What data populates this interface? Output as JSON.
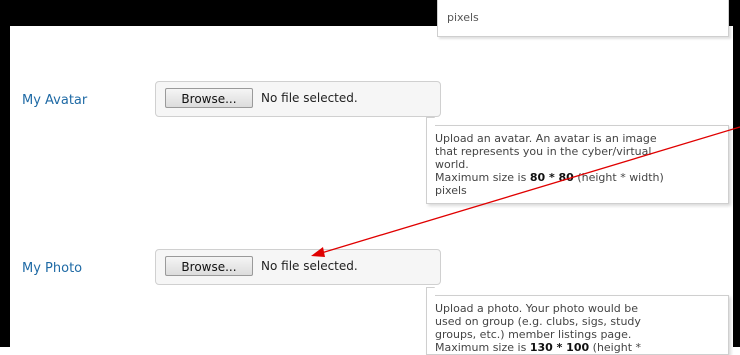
{
  "top_tooltip": {
    "text": "pixels"
  },
  "avatar": {
    "label": "My Avatar",
    "browse_label": "Browse...",
    "file_status": "No file selected.",
    "help_line1": "Upload an avatar. An avatar is an image",
    "help_line2": "that represents you in the cyber/virtual",
    "help_line3": "world.",
    "help_size_prefix": "Maximum size is ",
    "help_size_value": "80 * 80",
    "help_size_suffix": " (height * width)",
    "help_line5": "pixels"
  },
  "photo": {
    "label": "My Photo",
    "browse_label": "Browse...",
    "file_status": "No file selected.",
    "help_line1": "Upload a photo. Your photo would be",
    "help_line2": "used on group (e.g. clubs, sigs, study",
    "help_line3": "groups, etc.) member listings page.",
    "help_size_prefix": "Maximum size is ",
    "help_size_value": "130 * 100",
    "help_size_suffix": " (height *"
  },
  "colors": {
    "label": "#1f6aa5",
    "arrow": "#e00000",
    "frame": "#000000"
  }
}
